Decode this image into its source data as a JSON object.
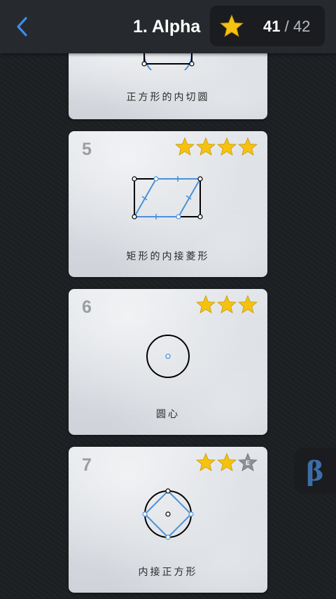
{
  "header": {
    "title": "1. Alpha",
    "score_earned": "41",
    "score_separator": " / ",
    "score_total": "42",
    "back_icon": "chevron-left-icon",
    "star_icon": "star-icon"
  },
  "levels": [
    {
      "label": "正方形的内切圆",
      "stars_earned": 0
    },
    {
      "number": "5",
      "label": "矩形的内接菱形",
      "stars_earned": 4
    },
    {
      "number": "6",
      "label": "圆心",
      "stars_earned": 3
    },
    {
      "number": "7",
      "label": "内接正方形",
      "stars_earned": 2,
      "stars_shown": 3,
      "bonus_badge": "E"
    }
  ],
  "side_tab": {
    "label": "β"
  },
  "colors": {
    "star": "#f5c211",
    "construction_blue": "#4a90d9",
    "back_blue": "#3a8ee6"
  }
}
